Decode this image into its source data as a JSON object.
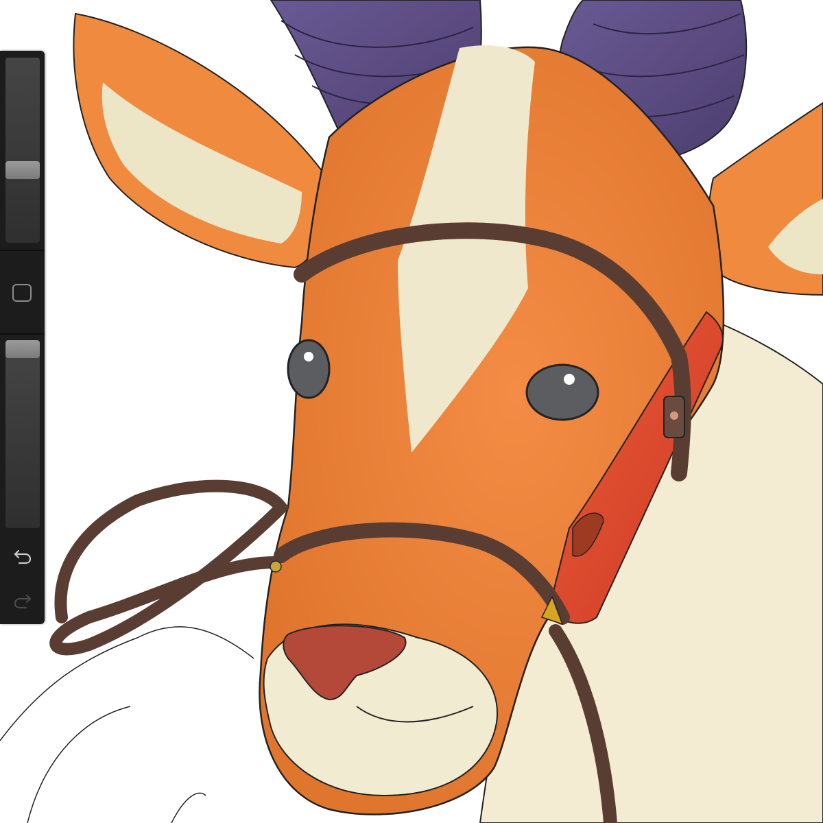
{
  "app": "drawing-canvas",
  "sidebar": {
    "brush_size_slider": {
      "value": 0.38
    },
    "brush_opacity_slider": {
      "value": 1.0
    },
    "modify_button": {
      "icon": "square-icon"
    },
    "undo_button": {
      "icon": "undo-icon",
      "enabled": true
    },
    "redo_button": {
      "icon": "redo-icon",
      "enabled": false
    }
  },
  "colors": {
    "sidebar_bg": "#1c1c1c",
    "fur_orange": "#f0873a",
    "cream": "#efe8cc",
    "horn_purple": "#5b4a80",
    "bridle_brown": "#5a3d32",
    "strap_red": "#e0452e",
    "nose": "#b4493a",
    "eye": "#5b5d61"
  }
}
